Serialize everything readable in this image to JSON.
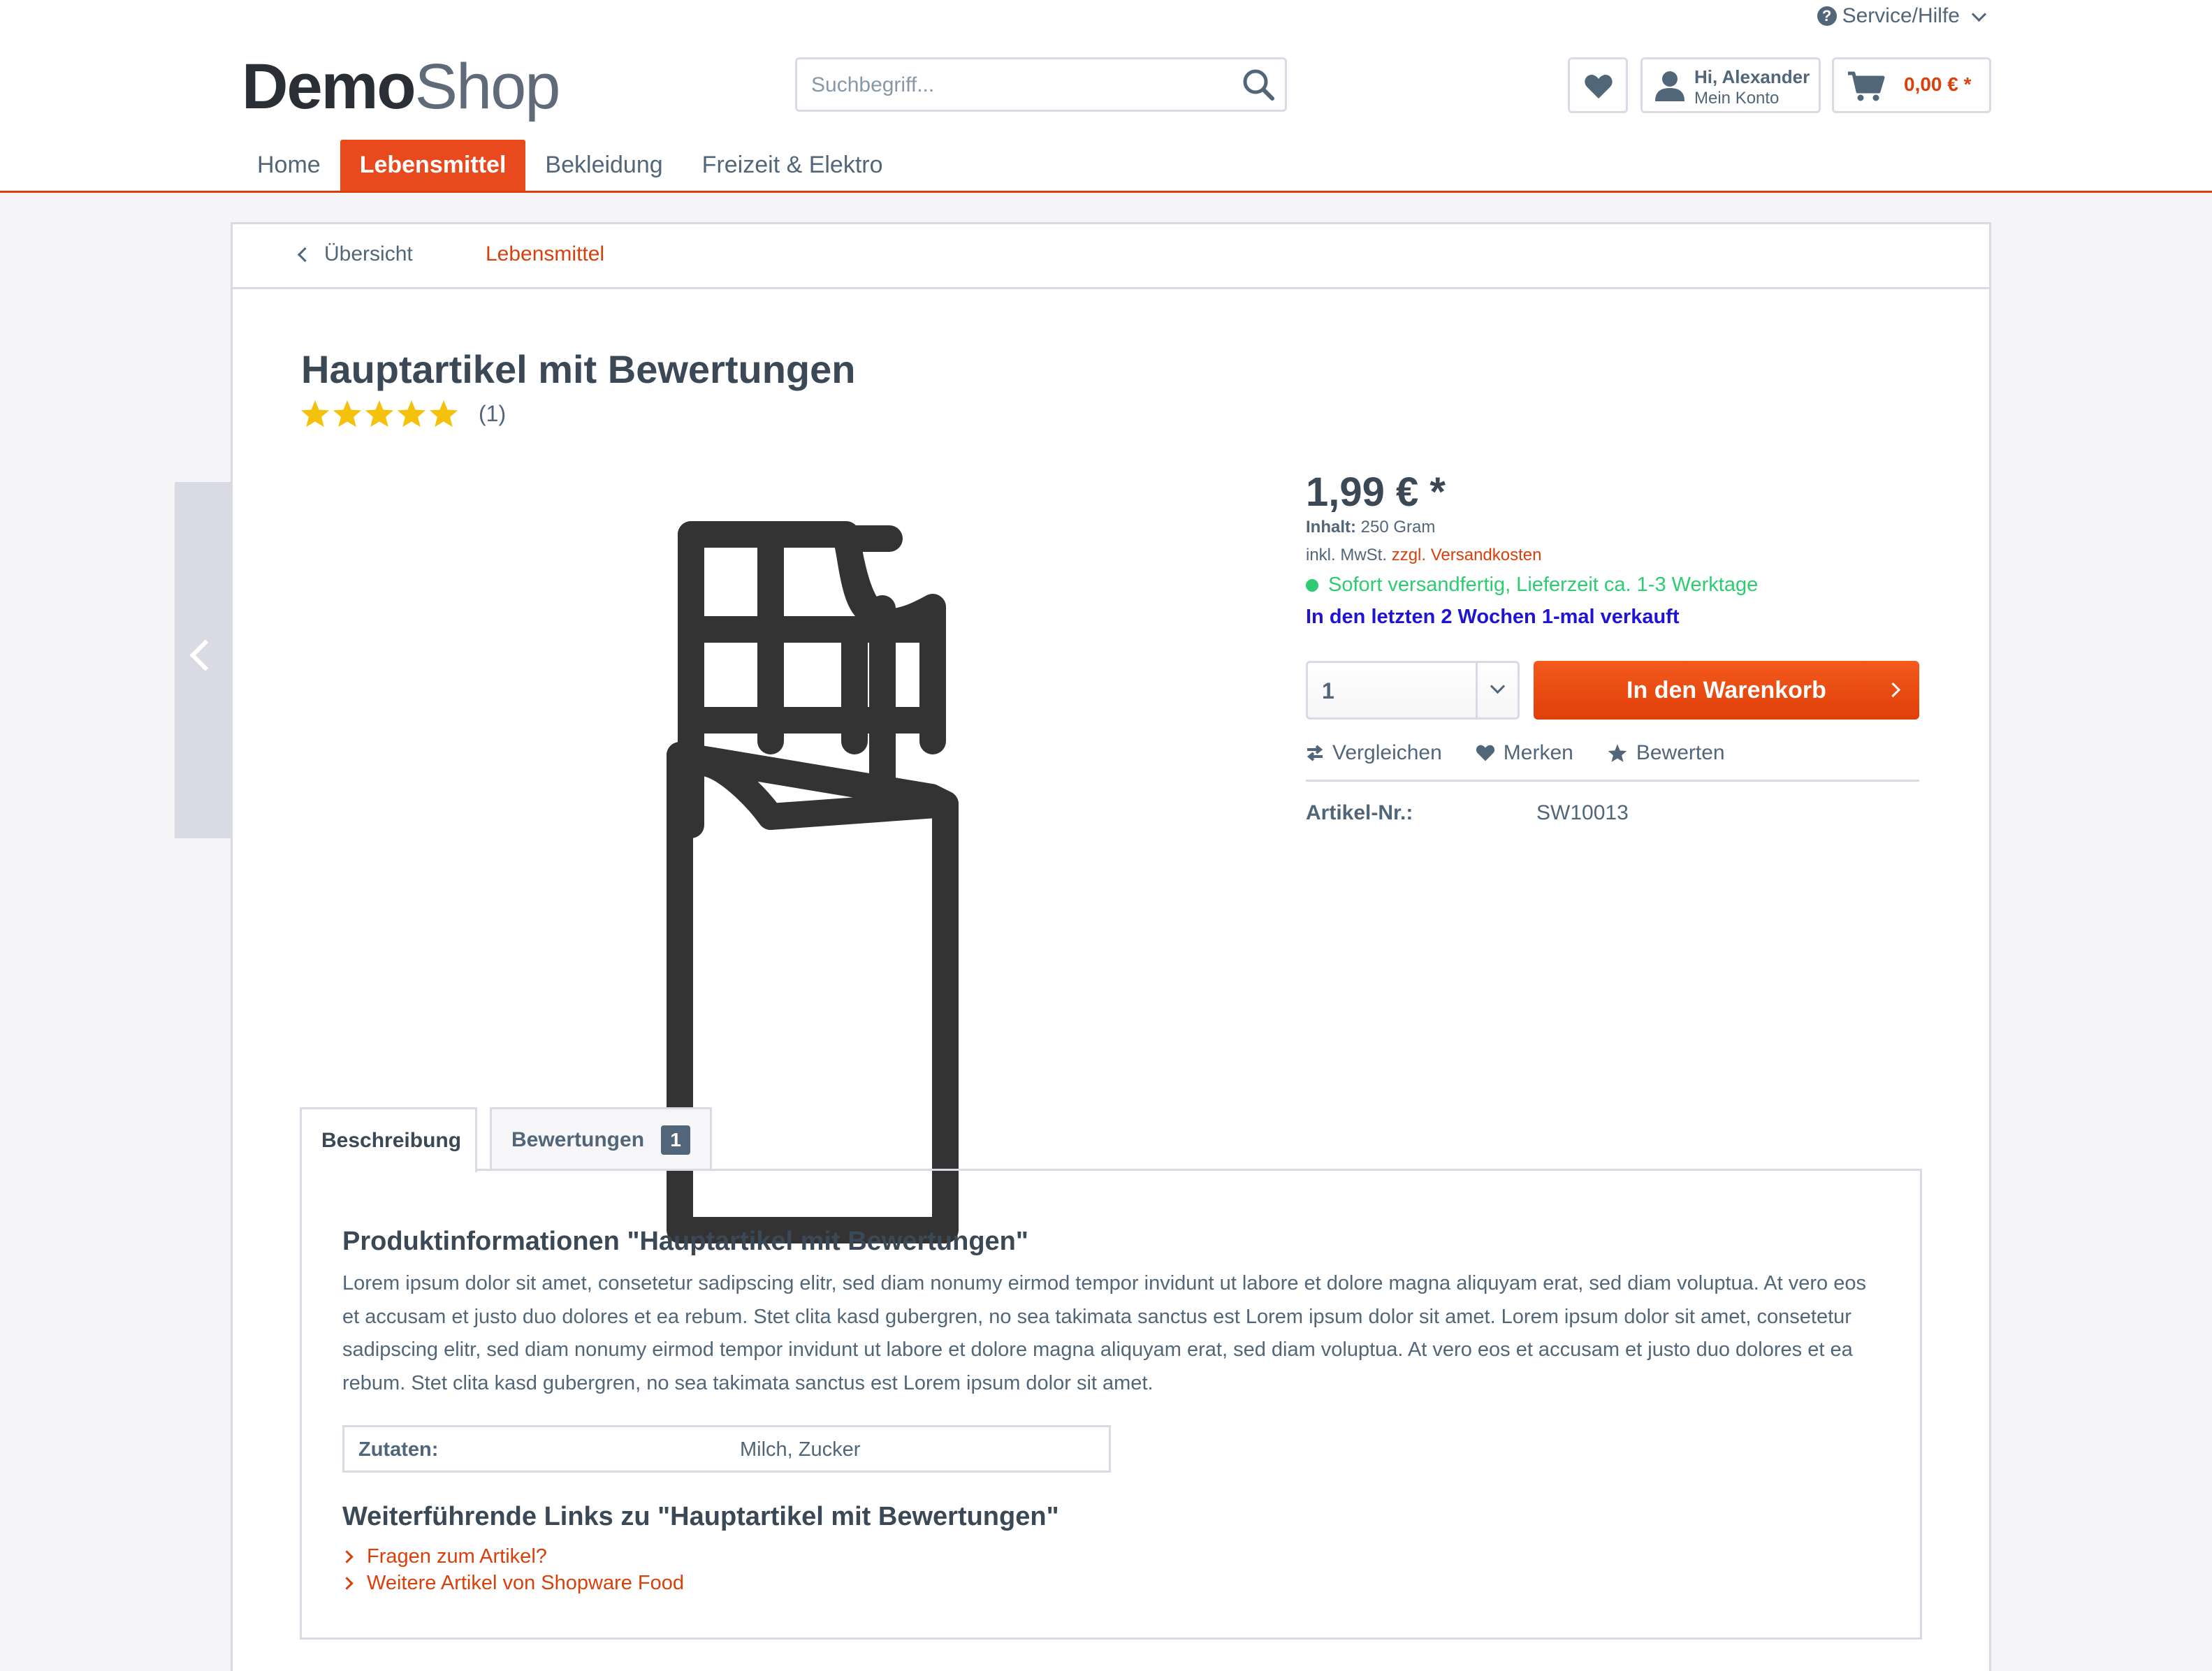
{
  "header": {
    "service_label": "Service/Hilfe",
    "logo_bold": "Demo",
    "logo_light": "Shop",
    "search_placeholder": "Suchbegriff...",
    "account_greeting": "Hi, Alexander",
    "account_label": "Mein Konto",
    "cart_amount": "0,00 € *"
  },
  "nav": {
    "items": [
      {
        "label": "Home"
      },
      {
        "label": "Lebensmittel",
        "active": true
      },
      {
        "label": "Bekleidung"
      },
      {
        "label": "Freizeit & Elektro"
      }
    ]
  },
  "breadcrumb": {
    "back_label": "Übersicht",
    "category": "Lebensmittel"
  },
  "product": {
    "title": "Hauptartikel mit Bewertungen",
    "rating_stars": 5,
    "rating_max": 5,
    "rating_count": "(1)",
    "image_icon": "chocolate-bar-icon"
  },
  "buybox": {
    "price": "1,99 € *",
    "content_label": "Inhalt:",
    "content_value": "250 Gram",
    "tax_text": "inkl. MwSt.",
    "shipping_link": "zzgl. Versandkosten",
    "delivery": "Sofort versandfertig, Lieferzeit ca. 1-3 Werktage",
    "sold_info": "In den letzten 2 Wochen 1-mal verkauft",
    "quantity": "1",
    "add_to_cart": "In den Warenkorb",
    "compare": "Vergleichen",
    "remember": "Merken",
    "review": "Bewerten",
    "article_no_label": "Artikel-Nr.:",
    "article_no": "SW10013"
  },
  "tabs": {
    "description": "Beschreibung",
    "reviews": "Bewertungen",
    "reviews_count": "1"
  },
  "description": {
    "heading": "Produktinformationen \"Hauptartikel mit Bewertungen\"",
    "text": "Lorem ipsum dolor sit amet, consetetur sadipscing elitr, sed diam nonumy eirmod tempor invidunt ut labore et dolore magna aliquyam erat, sed diam voluptua. At vero eos et accusam et justo duo dolores et ea rebum. Stet clita kasd gubergren, no sea takimata sanctus est Lorem ipsum dolor sit amet. Lorem ipsum dolor sit amet, consetetur sadipscing elitr, sed diam nonumy eirmod tempor invidunt ut labore et dolore magna aliquyam erat, sed diam voluptua. At vero eos et accusam et justo duo dolores et ea rebum. Stet clita kasd gubergren, no sea takimata sanctus est Lorem ipsum dolor sit amet.",
    "ingredients_label": "Zutaten:",
    "ingredients_value": "Milch, Zucker",
    "links_heading": "Weiterführende Links zu \"Hauptartikel mit Bewertungen\"",
    "link_questions": "Fragen zum Artikel?",
    "link_more": "Weitere Artikel von Shopware Food"
  },
  "colors": {
    "accent": "#e8491d",
    "link": "#d9400b",
    "text": "#52667a",
    "heading": "#3b4856",
    "success": "#2ecc71",
    "sold": "#1f14d6",
    "star": "#f5c20b",
    "border": "#dadae5"
  }
}
